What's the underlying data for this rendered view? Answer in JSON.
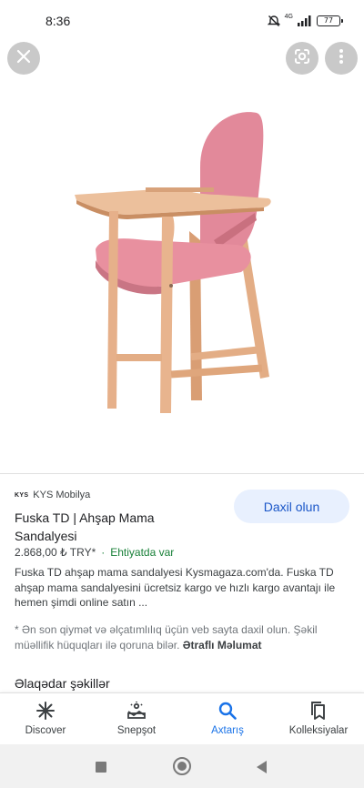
{
  "status_bar": {
    "time": "8:36",
    "network": "4G",
    "battery": "77",
    "icons": [
      "alarm-off-icon",
      "signal-icon",
      "battery-icon"
    ]
  },
  "image_viewer": {
    "close_icon": "close-icon",
    "lens_icon": "google-lens-icon",
    "more_icon": "more-vert-icon",
    "image_subject": "pink-wooden-high-chair"
  },
  "result": {
    "source_logo": "KYS",
    "source_name": "KYS Mobilya",
    "visit_label": "Daxil olun",
    "title": "Fuska TD | Ahşap Mama Sandalyesi",
    "price": "2.868,00 ₺ TRY*",
    "separator": "·",
    "stock": "Ehtiyatda var",
    "description": "Fuska TD ahşap mama sandalyesi Kysmagaza.com'da. Fuska TD ahşap mama sandalyesini ücretsiz kargo ve hızlı kargo avantajı ile hemen şimdi online satın ...",
    "disclaimer": "* Ən son qiymət və əlçatımlılıq üçün veb sayta daxil olun. Şəkil müəllifik hüquqları ilə qoruna bilər.",
    "more_info": "Ətraflı Məlumat",
    "related_heading": "Əlaqədar şəkillər"
  },
  "bottom_nav": {
    "items": [
      {
        "label": "Discover",
        "icon": "asterisk-icon",
        "active": false
      },
      {
        "label": "Snepşot",
        "icon": "snapshot-icon",
        "active": false
      },
      {
        "label": "Axtarış",
        "icon": "search-icon",
        "active": true
      },
      {
        "label": "Kolleksiyalar",
        "icon": "collections-icon",
        "active": false
      }
    ]
  },
  "colors": {
    "accent": "#1a73e8",
    "visit_bg": "#e8f0fe",
    "stock_green": "#188038",
    "chair_pink": "#e08a99",
    "wood": "#e3a87c"
  }
}
